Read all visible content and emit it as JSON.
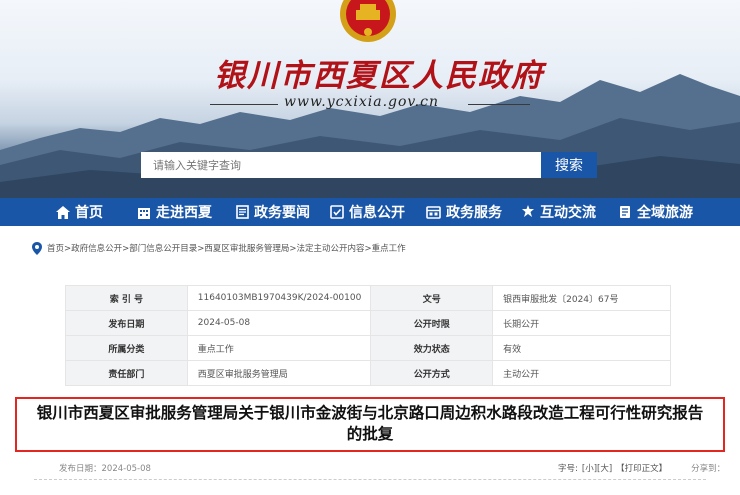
{
  "header": {
    "site_name": "银川市西夏区人民政府",
    "site_url": "www.ycxixia.gov.cn",
    "search_placeholder": "请输入关键字查询",
    "search_button": "搜索"
  },
  "nav": {
    "items": [
      {
        "label": "首页",
        "icon": "home-icon"
      },
      {
        "label": "走进西夏",
        "icon": "building-icon"
      },
      {
        "label": "政务要闻",
        "icon": "news-icon"
      },
      {
        "label": "信息公开",
        "icon": "document-icon"
      },
      {
        "label": "政务服务",
        "icon": "service-icon"
      },
      {
        "label": "互动交流",
        "icon": "interaction-icon"
      },
      {
        "label": "全域旅游",
        "icon": "travel-icon"
      }
    ]
  },
  "breadcrumb": {
    "icon": "location-pin-icon",
    "text": "首页>政府信息公开>部门信息公开目录>西夏区审批服务管理局>法定主动公开内容>重点工作"
  },
  "meta_table": {
    "rows": [
      {
        "k1": "索 引 号",
        "v1": "11640103MB1970439K/2024-00100",
        "k2": "文号",
        "v2": "银西审服批发〔2024〕67号"
      },
      {
        "k1": "发布日期",
        "v1": "2024-05-08",
        "k2": "公开时限",
        "v2": "长期公开"
      },
      {
        "k1": "所属分类",
        "v1": "重点工作",
        "k2": "效力状态",
        "v2": "有效"
      },
      {
        "k1": "责任部门",
        "v1": "西夏区审批服务管理局",
        "k2": "公开方式",
        "v2": "主动公开"
      }
    ]
  },
  "article": {
    "title": "银川市西夏区审批服务管理局关于银川市金波街与北京路口周边积水路段改造工程可行性研究报告的批复",
    "pub_date": "发布日期：2024-05-08",
    "font_size_label": "字号:",
    "font_size_options": "[小][大]",
    "print_label": "【打印正文】",
    "share_label": "分享到："
  },
  "colors": {
    "nav_blue": "#1a56a8",
    "title_red": "#b01218",
    "highlight_red": "#e1271f"
  }
}
